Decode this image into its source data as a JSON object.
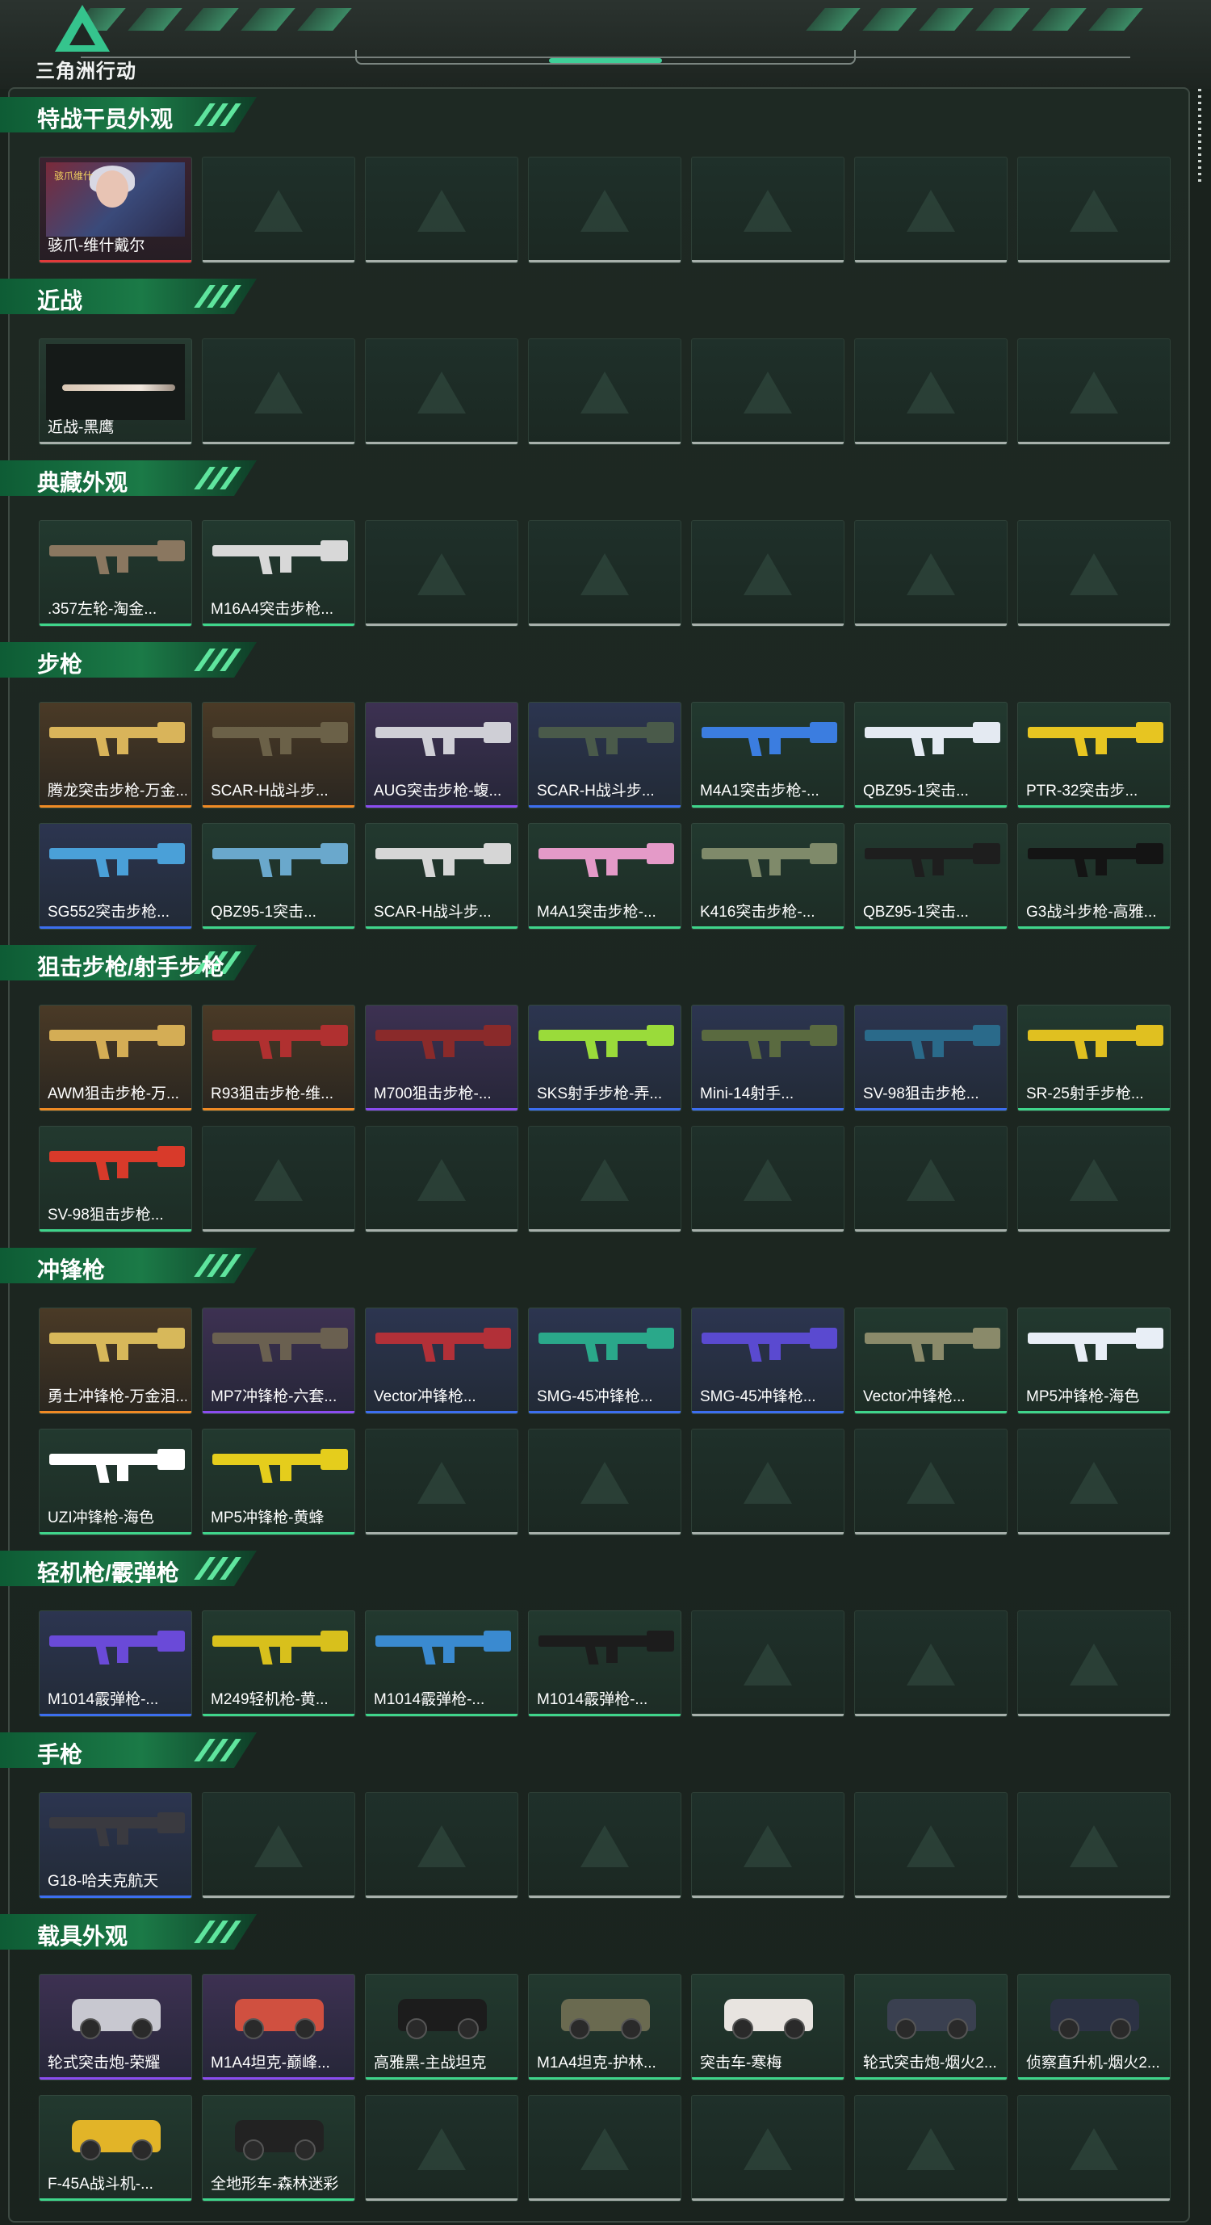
{
  "header": {
    "logo_text": "三角洲行动"
  },
  "sections": [
    {
      "title": "特战干员外观",
      "items": [
        {
          "label": "骇爪-维什戴尔",
          "rarity": "red",
          "kind": "portrait",
          "badge": "骇爪维什"
        }
      ]
    },
    {
      "title": "近战",
      "items": [
        {
          "label": "近战-黑鹰",
          "rarity": "gray",
          "kind": "knife"
        }
      ]
    },
    {
      "title": "典藏外观",
      "items": [
        {
          "label": ".357左轮-淘金...",
          "rarity": "green",
          "kind": "gun",
          "color": "#8a7760"
        },
        {
          "label": "M16A4突击步枪...",
          "rarity": "green",
          "kind": "gun",
          "color": "#d8d8d8"
        }
      ]
    },
    {
      "title": "步枪",
      "items": [
        {
          "label": "腾龙突击步枪-万金...",
          "rarity": "gold",
          "kind": "gun",
          "color": "#d9b45a"
        },
        {
          "label": "SCAR-H战斗步...",
          "rarity": "gold",
          "kind": "gun",
          "color": "#6b6148"
        },
        {
          "label": "AUG突击步枪-蝮...",
          "rarity": "purple",
          "kind": "gun",
          "color": "#cfcfd6"
        },
        {
          "label": "SCAR-H战斗步...",
          "rarity": "blue",
          "kind": "gun",
          "color": "#4a5a4a"
        },
        {
          "label": "M4A1突击步枪-...",
          "rarity": "green",
          "kind": "gun",
          "color": "#3b7de0"
        },
        {
          "label": "QBZ95-1突击...",
          "rarity": "green",
          "kind": "gun",
          "color": "#e4eaf2"
        },
        {
          "label": "PTR-32突击步...",
          "rarity": "green",
          "kind": "gun",
          "color": "#e7c521"
        },
        {
          "label": "SG552突击步枪...",
          "rarity": "blue",
          "kind": "gun",
          "color": "#4aa0d8"
        },
        {
          "label": "QBZ95-1突击...",
          "rarity": "green",
          "kind": "gun",
          "color": "#6aa8cc"
        },
        {
          "label": "SCAR-H战斗步...",
          "rarity": "green",
          "kind": "gun",
          "color": "#d6d6d6"
        },
        {
          "label": "M4A1突击步枪-...",
          "rarity": "green",
          "kind": "gun",
          "color": "#e49ac8"
        },
        {
          "label": "K416突击步枪-...",
          "rarity": "green",
          "kind": "gun",
          "color": "#7f8a6a"
        },
        {
          "label": "QBZ95-1突击...",
          "rarity": "green",
          "kind": "gun",
          "color": "#1e1e1e"
        },
        {
          "label": "G3战斗步枪-高雅...",
          "rarity": "green",
          "kind": "gun",
          "color": "#141414"
        }
      ]
    },
    {
      "title": "狙击步枪/射手步枪",
      "items": [
        {
          "label": "AWM狙击步枪-万...",
          "rarity": "gold",
          "kind": "gun",
          "color": "#d4ad55"
        },
        {
          "label": "R93狙击步枪-维...",
          "rarity": "gold",
          "kind": "gun",
          "color": "#b03030"
        },
        {
          "label": "M700狙击步枪-...",
          "rarity": "purple",
          "kind": "gun",
          "color": "#8a2a2a"
        },
        {
          "label": "SKS射手步枪-弄...",
          "rarity": "blue",
          "kind": "gun",
          "color": "#9adb3a"
        },
        {
          "label": "Mini-14射手...",
          "rarity": "blue",
          "kind": "gun",
          "color": "#5a6a40"
        },
        {
          "label": "SV-98狙击步枪...",
          "rarity": "blue",
          "kind": "gun",
          "color": "#2a6a8a"
        },
        {
          "label": "SR-25射手步枪...",
          "rarity": "green",
          "kind": "gun",
          "color": "#e0c020"
        },
        {
          "label": "SV-98狙击步枪...",
          "rarity": "green",
          "kind": "gun",
          "color": "#d83a2a"
        }
      ]
    },
    {
      "title": "冲锋枪",
      "items": [
        {
          "label": "勇士冲锋枪-万金泪...",
          "rarity": "gold",
          "kind": "gun",
          "color": "#d7b85a"
        },
        {
          "label": "MP7冲锋枪-六套...",
          "rarity": "purple",
          "kind": "gun",
          "color": "#6a6050"
        },
        {
          "label": "Vector冲锋枪...",
          "rarity": "blue",
          "kind": "gun",
          "color": "#b23038"
        },
        {
          "label": "SMG-45冲锋枪...",
          "rarity": "blue",
          "kind": "gun",
          "color": "#2aa88a"
        },
        {
          "label": "SMG-45冲锋枪...",
          "rarity": "blue",
          "kind": "gun",
          "color": "#5a4ad0"
        },
        {
          "label": "Vector冲锋枪...",
          "rarity": "green",
          "kind": "gun",
          "color": "#8a8a6a"
        },
        {
          "label": "MP5冲锋枪-海色",
          "rarity": "green",
          "kind": "gun",
          "color": "#e8eef6"
        },
        {
          "label": "UZI冲锋枪-海色",
          "rarity": "green",
          "kind": "gun",
          "color": "#ffffff"
        },
        {
          "label": "MP5冲锋枪-黄蜂",
          "rarity": "green",
          "kind": "gun",
          "color": "#e5cd1c"
        }
      ]
    },
    {
      "title": "轻机枪/霰弹枪",
      "items": [
        {
          "label": "M1014霰弹枪-...",
          "rarity": "blue",
          "kind": "gun",
          "color": "#6a4ad8"
        },
        {
          "label": "M249轻机枪-黄...",
          "rarity": "green",
          "kind": "gun",
          "color": "#d8c01c"
        },
        {
          "label": "M1014霰弹枪-...",
          "rarity": "green",
          "kind": "gun",
          "color": "#3a8ad0"
        },
        {
          "label": "M1014霰弹枪-...",
          "rarity": "green",
          "kind": "gun",
          "color": "#1c1c1c"
        }
      ]
    },
    {
      "title": "手枪",
      "items": [
        {
          "label": "G18-哈夫克航天",
          "rarity": "blue",
          "kind": "gun",
          "color": "#3a3a40"
        }
      ]
    },
    {
      "title": "载具外观",
      "items": [
        {
          "label": "轮式突击炮-荣耀",
          "rarity": "purple",
          "kind": "vehicle",
          "color": "#c8c8d0"
        },
        {
          "label": "M1A4坦克-巅峰...",
          "rarity": "purple",
          "kind": "vehicle",
          "color": "#d05040"
        },
        {
          "label": "高雅黑-主战坦克",
          "rarity": "green",
          "kind": "vehicle",
          "color": "#1c1c1c"
        },
        {
          "label": "M1A4坦克-护林...",
          "rarity": "green",
          "kind": "vehicle",
          "color": "#6a6a50"
        },
        {
          "label": "突击车-寒梅",
          "rarity": "green",
          "kind": "vehicle",
          "color": "#e8e4e0"
        },
        {
          "label": "轮式突击炮-烟火2...",
          "rarity": "green",
          "kind": "vehicle",
          "color": "#3a4050"
        },
        {
          "label": "侦察直升机-烟火2...",
          "rarity": "green",
          "kind": "vehicle",
          "color": "#2c3244"
        },
        {
          "label": "F-45A战斗机-...",
          "rarity": "green",
          "kind": "vehicle",
          "color": "#e2b428"
        },
        {
          "label": "全地形车-森林迷彩",
          "rarity": "green",
          "kind": "vehicle",
          "color": "#222222"
        }
      ]
    }
  ]
}
